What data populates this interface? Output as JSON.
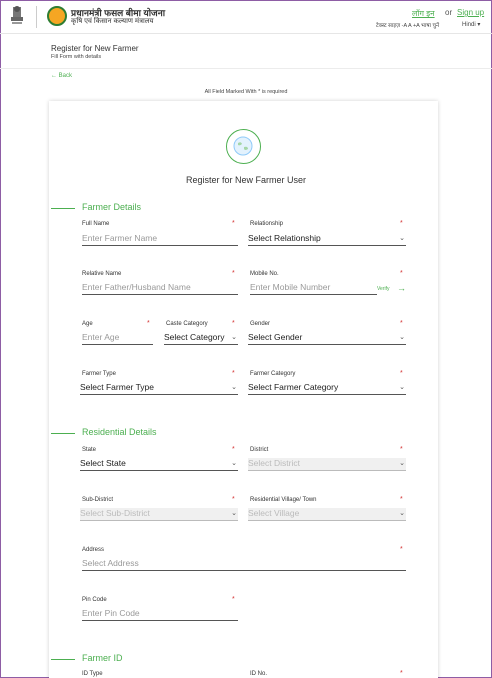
{
  "header": {
    "hindi_title": "प्रधानमंत्री फसल बीमा योजना",
    "hindi_subtitle": "कृषि एवं किसान कल्याण मंत्रालय",
    "login": "लॉग इन",
    "or": "or",
    "signup": "Sign up",
    "accessibility": "टेक्स्ट साइज़ -A A +A  भाषा चुनें",
    "language": "Hindi ▾"
  },
  "page": {
    "title": "Register for New Farmer",
    "subtitle": "Fill Form with details",
    "back": "← Back",
    "required_note": "All Field Marked With * is required"
  },
  "card": {
    "title": "Register for New Farmer User"
  },
  "sections": {
    "farmer_details": "Farmer Details",
    "residential_details": "Residential Details",
    "farmer_id": "Farmer ID"
  },
  "fields": {
    "full_name": {
      "label": "Full Name",
      "placeholder": "Enter Farmer Name"
    },
    "relationship": {
      "label": "Relationship",
      "value": "Select Relationship"
    },
    "relative_name": {
      "label": "Relative Name",
      "placeholder": "Enter Father/Husband Name"
    },
    "mobile": {
      "label": "Mobile No.",
      "placeholder": "Enter Mobile Number",
      "verify": "Verify"
    },
    "age": {
      "label": "Age",
      "placeholder": "Enter Age"
    },
    "caste": {
      "label": "Caste Category",
      "value": "Select Category"
    },
    "gender": {
      "label": "Gender",
      "value": "Select Gender"
    },
    "farmer_type": {
      "label": "Farmer Type",
      "value": "Select Farmer Type"
    },
    "farmer_category": {
      "label": "Farmer Category",
      "value": "Select Farmer Category"
    },
    "state": {
      "label": "State",
      "value": "Select State"
    },
    "district": {
      "label": "District",
      "value": "Select District"
    },
    "sub_district": {
      "label": "Sub-District",
      "value": "Select Sub-District"
    },
    "village": {
      "label": "Residential Village/ Town",
      "value": "Select Village"
    },
    "address": {
      "label": "Address",
      "placeholder": "Select Address"
    },
    "pin_code": {
      "label": "Pin Code",
      "placeholder": "Enter Pin Code"
    },
    "id_type": {
      "label": "ID Type"
    },
    "id_no": {
      "label": "ID No."
    }
  },
  "colors": {
    "accent": "#4caf50",
    "frame": "#8e5da5",
    "required": "#d32f2f"
  }
}
